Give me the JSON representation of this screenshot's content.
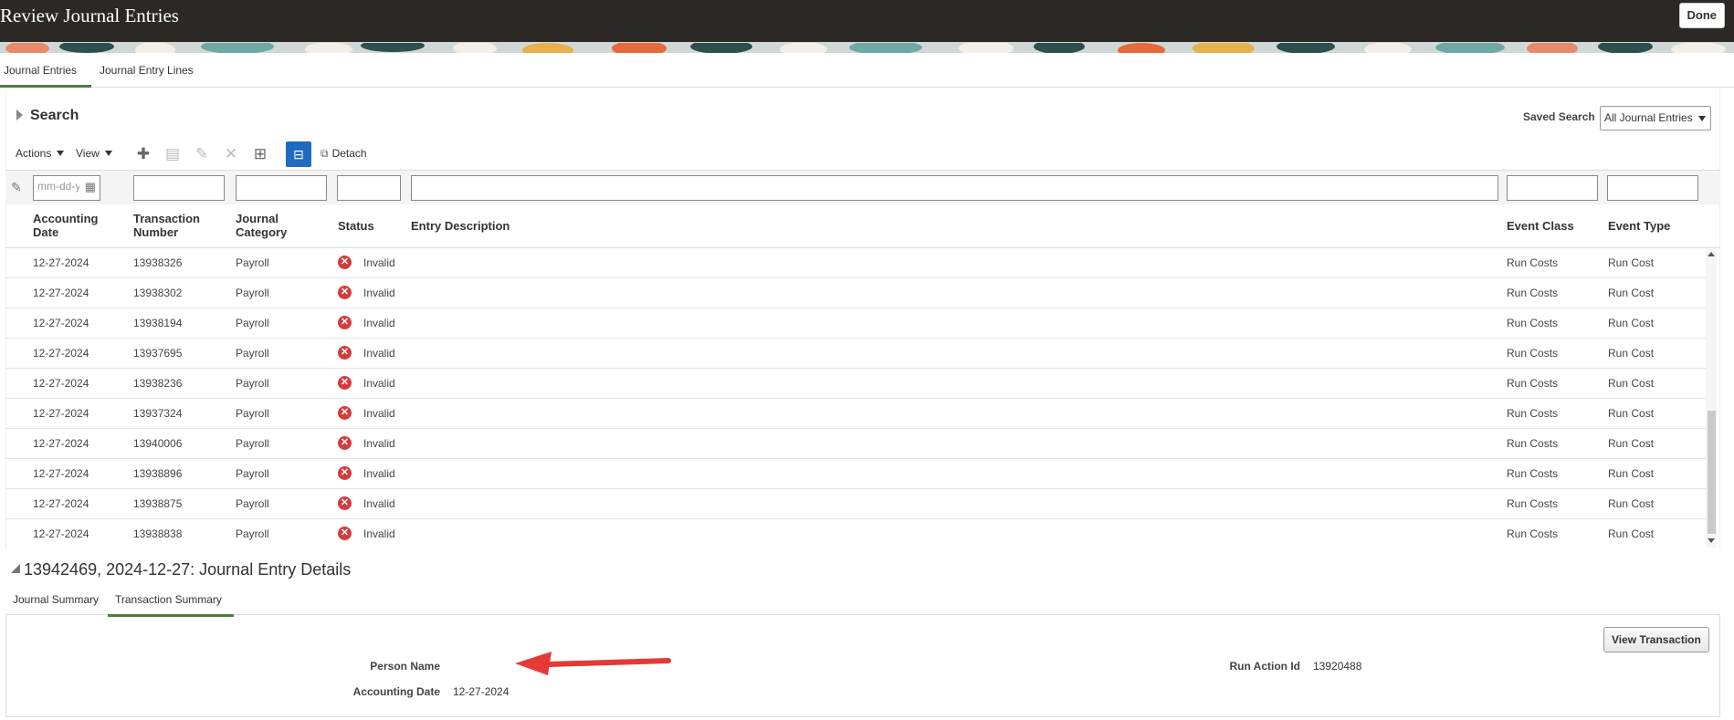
{
  "header": {
    "title": "Review Journal Entries",
    "done_label": "Done"
  },
  "tabs": [
    {
      "label": "Journal Entries",
      "active": true
    },
    {
      "label": "Journal Entry Lines",
      "active": false
    }
  ],
  "search": {
    "title": "Search",
    "saved_search_label": "Saved Search",
    "saved_search_value": "All Journal Entries"
  },
  "toolbar": {
    "actions_label": "Actions",
    "view_label": "View",
    "detach_label": "Detach",
    "icons": [
      "plus-icon",
      "duplicate-icon",
      "edit-icon",
      "delete-icon",
      "export-icon",
      "freeze-icon",
      "detach-icon"
    ]
  },
  "filters": {
    "date_placeholder": "mm-dd-yyyy"
  },
  "table": {
    "columns": [
      "Accounting Date",
      "Transaction Number",
      "Journal Category",
      "Status",
      "Entry Description",
      "Event Class",
      "Event Type"
    ],
    "rows": [
      {
        "date": "12-27-2024",
        "txn": "13938326",
        "category": "Payroll",
        "status": "Invalid",
        "description": "",
        "event_class": "Run Costs",
        "event_type": "Run Cost"
      },
      {
        "date": "12-27-2024",
        "txn": "13938302",
        "category": "Payroll",
        "status": "Invalid",
        "description": "",
        "event_class": "Run Costs",
        "event_type": "Run Cost"
      },
      {
        "date": "12-27-2024",
        "txn": "13938194",
        "category": "Payroll",
        "status": "Invalid",
        "description": "",
        "event_class": "Run Costs",
        "event_type": "Run Cost"
      },
      {
        "date": "12-27-2024",
        "txn": "13937695",
        "category": "Payroll",
        "status": "Invalid",
        "description": "",
        "event_class": "Run Costs",
        "event_type": "Run Cost"
      },
      {
        "date": "12-27-2024",
        "txn": "13938236",
        "category": "Payroll",
        "status": "Invalid",
        "description": "",
        "event_class": "Run Costs",
        "event_type": "Run Cost"
      },
      {
        "date": "12-27-2024",
        "txn": "13937324",
        "category": "Payroll",
        "status": "Invalid",
        "description": "",
        "event_class": "Run Costs",
        "event_type": "Run Cost"
      },
      {
        "date": "12-27-2024",
        "txn": "13940006",
        "category": "Payroll",
        "status": "Invalid",
        "description": "",
        "event_class": "Run Costs",
        "event_type": "Run Cost"
      },
      {
        "date": "12-27-2024",
        "txn": "13938896",
        "category": "Payroll",
        "status": "Invalid",
        "description": "",
        "event_class": "Run Costs",
        "event_type": "Run Cost"
      },
      {
        "date": "12-27-2024",
        "txn": "13938875",
        "category": "Payroll",
        "status": "Invalid",
        "description": "",
        "event_class": "Run Costs",
        "event_type": "Run Cost"
      },
      {
        "date": "12-27-2024",
        "txn": "13938838",
        "category": "Payroll",
        "status": "Invalid",
        "description": "",
        "event_class": "Run Costs",
        "event_type": "Run Cost"
      }
    ]
  },
  "details": {
    "title": "13942469, 2024-12-27: Journal Entry Details",
    "tabs": [
      {
        "label": "Journal Summary",
        "active": false
      },
      {
        "label": "Transaction Summary",
        "active": true
      }
    ],
    "view_transaction_label": "View Transaction",
    "fields": {
      "person_name_label": "Person Name",
      "person_name_value": "",
      "accounting_date_label": "Accounting Date",
      "accounting_date_value": "12-27-2024",
      "run_action_id_label": "Run Action Id",
      "run_action_id_value": "13920488"
    }
  },
  "colors": {
    "header_bg": "#2b2826",
    "accent_green": "#4d7c3f",
    "error_red": "#d63b3b",
    "primary_blue": "#1f6bbf",
    "arrow_red": "#e53935"
  }
}
